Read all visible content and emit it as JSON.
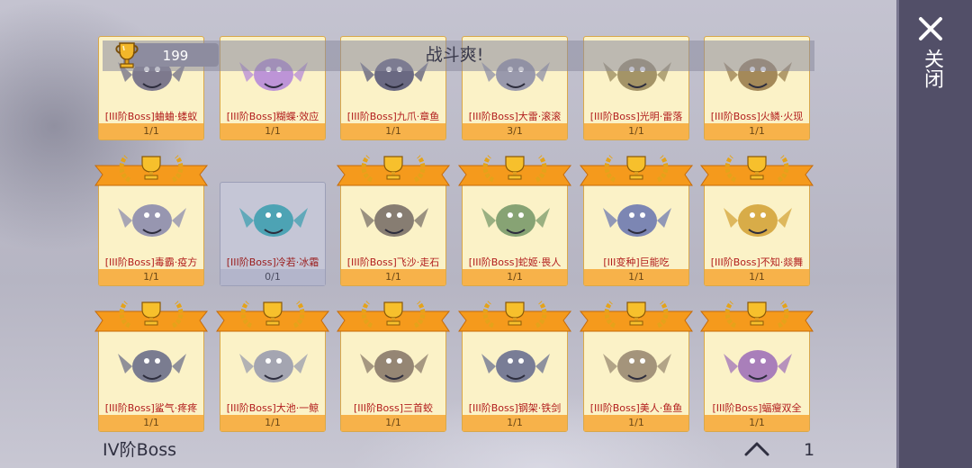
{
  "header": {
    "score": "199",
    "title": "战斗爽!"
  },
  "side": {
    "close_label": "关闭"
  },
  "footer": {
    "tier_label": "IV阶Boss",
    "page": "1"
  },
  "rows": [
    {
      "cards": [
        {
          "name": "[III阶Boss]蛐蛐·蝼蚁",
          "count": "1/1",
          "owned": true,
          "icon": "moth-boss-art",
          "color": "#6f6c86"
        },
        {
          "name": "[III阶Boss]糊蝶·效应",
          "count": "1/1",
          "owned": true,
          "icon": "butterfly-boss-art",
          "color": "#b68ad8"
        },
        {
          "name": "[III阶Boss]九爪·章鱼",
          "count": "1/1",
          "owned": true,
          "icon": "octopus-boss-art",
          "color": "#5a5a7a"
        },
        {
          "name": "[III阶Boss]大雷·滚滚",
          "count": "3/1",
          "owned": true,
          "icon": "thunder-boss-art",
          "color": "#8e8fa8"
        },
        {
          "name": "[III阶Boss]光明·雷落",
          "count": "1/1",
          "owned": true,
          "icon": "light-boss-art",
          "color": "#9a8a5c"
        },
        {
          "name": "[III阶Boss]火鳞·火现",
          "count": "1/1",
          "owned": true,
          "icon": "fire-scale-boss-art",
          "color": "#9a7d4c"
        }
      ]
    },
    {
      "cards": [
        {
          "name": "[III阶Boss]毒霸·疫方",
          "count": "1/1",
          "owned": true,
          "icon": "poison-dragon-art",
          "color": "#8c8cad"
        },
        {
          "name": "[III阶Boss]冷若·冰霜",
          "count": "0/1",
          "owned": false,
          "icon": "ice-dragon-art",
          "color": "#3f9fb0"
        },
        {
          "name": "[III阶Boss]飞沙·走石",
          "count": "1/1",
          "owned": true,
          "icon": "sand-dragon-art",
          "color": "#7a7068"
        },
        {
          "name": "[III阶Boss]蛇姬·畏人",
          "count": "1/1",
          "owned": true,
          "icon": "snake-queen-art",
          "color": "#7a9a6a"
        },
        {
          "name": "[III变种]巨能吃",
          "count": "1/1",
          "owned": true,
          "icon": "big-eater-art",
          "color": "#6e7ab0"
        },
        {
          "name": "[III阶Boss]不知·燚舞",
          "count": "1/1",
          "owned": true,
          "icon": "flame-dancer-art",
          "color": "#d4a43a"
        }
      ]
    },
    {
      "cards": [
        {
          "name": "[III阶Boss]鲨气·疼疼",
          "count": "1/1",
          "owned": true,
          "icon": "shark-boss-art",
          "color": "#6c6f8a"
        },
        {
          "name": "[III阶Boss]大池·一鲸",
          "count": "1/1",
          "owned": true,
          "icon": "whale-boss-art",
          "color": "#9a9cae"
        },
        {
          "name": "[III阶Boss]三首蛟",
          "count": "1/1",
          "owned": true,
          "icon": "three-headed-dragon-art",
          "color": "#8a7a6a"
        },
        {
          "name": "[III阶Boss]钢架·铁剑",
          "count": "1/1",
          "owned": true,
          "icon": "steel-frame-art",
          "color": "#6a7090"
        },
        {
          "name": "[III阶Boss]美人·鱼鱼",
          "count": "1/1",
          "owned": true,
          "icon": "mermaid-boss-art",
          "color": "#9a8a72"
        },
        {
          "name": "[III阶Boss]蝠瘦双全",
          "count": "1/1",
          "owned": true,
          "icon": "bat-boss-art",
          "color": "#a072b8"
        }
      ]
    }
  ]
}
